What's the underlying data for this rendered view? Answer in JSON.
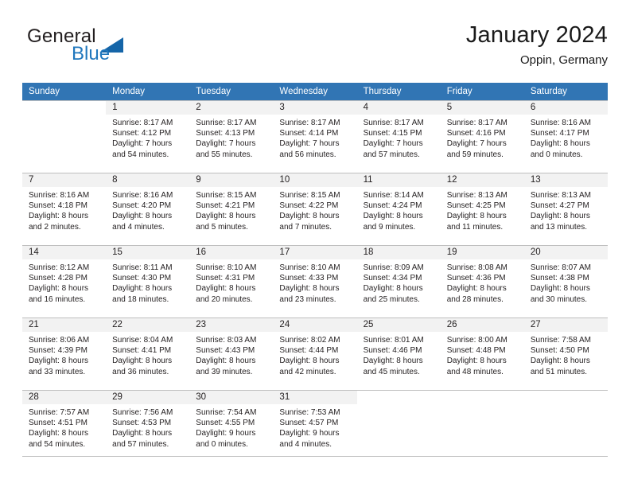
{
  "brand": {
    "word1": "General",
    "word2": "Blue",
    "triangle_color": "#1565a8",
    "blue_color": "#2077bd"
  },
  "header": {
    "title": "January 2024",
    "subtitle": "Oppin, Germany"
  },
  "theme": {
    "header_bg": "#3175b4",
    "daynum_bg": "#f2f2f2",
    "rule_color": "#bfbfbf"
  },
  "weekdays": [
    "Sunday",
    "Monday",
    "Tuesday",
    "Wednesday",
    "Thursday",
    "Friday",
    "Saturday"
  ],
  "weeks": [
    [
      {
        "date": "",
        "sunrise": "",
        "sunset": "",
        "daylight1": "",
        "daylight2": "",
        "empty": true
      },
      {
        "date": "1",
        "sunrise": "Sunrise: 8:17 AM",
        "sunset": "Sunset: 4:12 PM",
        "daylight1": "Daylight: 7 hours",
        "daylight2": "and 54 minutes."
      },
      {
        "date": "2",
        "sunrise": "Sunrise: 8:17 AM",
        "sunset": "Sunset: 4:13 PM",
        "daylight1": "Daylight: 7 hours",
        "daylight2": "and 55 minutes."
      },
      {
        "date": "3",
        "sunrise": "Sunrise: 8:17 AM",
        "sunset": "Sunset: 4:14 PM",
        "daylight1": "Daylight: 7 hours",
        "daylight2": "and 56 minutes."
      },
      {
        "date": "4",
        "sunrise": "Sunrise: 8:17 AM",
        "sunset": "Sunset: 4:15 PM",
        "daylight1": "Daylight: 7 hours",
        "daylight2": "and 57 minutes."
      },
      {
        "date": "5",
        "sunrise": "Sunrise: 8:17 AM",
        "sunset": "Sunset: 4:16 PM",
        "daylight1": "Daylight: 7 hours",
        "daylight2": "and 59 minutes."
      },
      {
        "date": "6",
        "sunrise": "Sunrise: 8:16 AM",
        "sunset": "Sunset: 4:17 PM",
        "daylight1": "Daylight: 8 hours",
        "daylight2": "and 0 minutes."
      }
    ],
    [
      {
        "date": "7",
        "sunrise": "Sunrise: 8:16 AM",
        "sunset": "Sunset: 4:18 PM",
        "daylight1": "Daylight: 8 hours",
        "daylight2": "and 2 minutes."
      },
      {
        "date": "8",
        "sunrise": "Sunrise: 8:16 AM",
        "sunset": "Sunset: 4:20 PM",
        "daylight1": "Daylight: 8 hours",
        "daylight2": "and 4 minutes."
      },
      {
        "date": "9",
        "sunrise": "Sunrise: 8:15 AM",
        "sunset": "Sunset: 4:21 PM",
        "daylight1": "Daylight: 8 hours",
        "daylight2": "and 5 minutes."
      },
      {
        "date": "10",
        "sunrise": "Sunrise: 8:15 AM",
        "sunset": "Sunset: 4:22 PM",
        "daylight1": "Daylight: 8 hours",
        "daylight2": "and 7 minutes."
      },
      {
        "date": "11",
        "sunrise": "Sunrise: 8:14 AM",
        "sunset": "Sunset: 4:24 PM",
        "daylight1": "Daylight: 8 hours",
        "daylight2": "and 9 minutes."
      },
      {
        "date": "12",
        "sunrise": "Sunrise: 8:13 AM",
        "sunset": "Sunset: 4:25 PM",
        "daylight1": "Daylight: 8 hours",
        "daylight2": "and 11 minutes."
      },
      {
        "date": "13",
        "sunrise": "Sunrise: 8:13 AM",
        "sunset": "Sunset: 4:27 PM",
        "daylight1": "Daylight: 8 hours",
        "daylight2": "and 13 minutes."
      }
    ],
    [
      {
        "date": "14",
        "sunrise": "Sunrise: 8:12 AM",
        "sunset": "Sunset: 4:28 PM",
        "daylight1": "Daylight: 8 hours",
        "daylight2": "and 16 minutes."
      },
      {
        "date": "15",
        "sunrise": "Sunrise: 8:11 AM",
        "sunset": "Sunset: 4:30 PM",
        "daylight1": "Daylight: 8 hours",
        "daylight2": "and 18 minutes."
      },
      {
        "date": "16",
        "sunrise": "Sunrise: 8:10 AM",
        "sunset": "Sunset: 4:31 PM",
        "daylight1": "Daylight: 8 hours",
        "daylight2": "and 20 minutes."
      },
      {
        "date": "17",
        "sunrise": "Sunrise: 8:10 AM",
        "sunset": "Sunset: 4:33 PM",
        "daylight1": "Daylight: 8 hours",
        "daylight2": "and 23 minutes."
      },
      {
        "date": "18",
        "sunrise": "Sunrise: 8:09 AM",
        "sunset": "Sunset: 4:34 PM",
        "daylight1": "Daylight: 8 hours",
        "daylight2": "and 25 minutes."
      },
      {
        "date": "19",
        "sunrise": "Sunrise: 8:08 AM",
        "sunset": "Sunset: 4:36 PM",
        "daylight1": "Daylight: 8 hours",
        "daylight2": "and 28 minutes."
      },
      {
        "date": "20",
        "sunrise": "Sunrise: 8:07 AM",
        "sunset": "Sunset: 4:38 PM",
        "daylight1": "Daylight: 8 hours",
        "daylight2": "and 30 minutes."
      }
    ],
    [
      {
        "date": "21",
        "sunrise": "Sunrise: 8:06 AM",
        "sunset": "Sunset: 4:39 PM",
        "daylight1": "Daylight: 8 hours",
        "daylight2": "and 33 minutes."
      },
      {
        "date": "22",
        "sunrise": "Sunrise: 8:04 AM",
        "sunset": "Sunset: 4:41 PM",
        "daylight1": "Daylight: 8 hours",
        "daylight2": "and 36 minutes."
      },
      {
        "date": "23",
        "sunrise": "Sunrise: 8:03 AM",
        "sunset": "Sunset: 4:43 PM",
        "daylight1": "Daylight: 8 hours",
        "daylight2": "and 39 minutes."
      },
      {
        "date": "24",
        "sunrise": "Sunrise: 8:02 AM",
        "sunset": "Sunset: 4:44 PM",
        "daylight1": "Daylight: 8 hours",
        "daylight2": "and 42 minutes."
      },
      {
        "date": "25",
        "sunrise": "Sunrise: 8:01 AM",
        "sunset": "Sunset: 4:46 PM",
        "daylight1": "Daylight: 8 hours",
        "daylight2": "and 45 minutes."
      },
      {
        "date": "26",
        "sunrise": "Sunrise: 8:00 AM",
        "sunset": "Sunset: 4:48 PM",
        "daylight1": "Daylight: 8 hours",
        "daylight2": "and 48 minutes."
      },
      {
        "date": "27",
        "sunrise": "Sunrise: 7:58 AM",
        "sunset": "Sunset: 4:50 PM",
        "daylight1": "Daylight: 8 hours",
        "daylight2": "and 51 minutes."
      }
    ],
    [
      {
        "date": "28",
        "sunrise": "Sunrise: 7:57 AM",
        "sunset": "Sunset: 4:51 PM",
        "daylight1": "Daylight: 8 hours",
        "daylight2": "and 54 minutes."
      },
      {
        "date": "29",
        "sunrise": "Sunrise: 7:56 AM",
        "sunset": "Sunset: 4:53 PM",
        "daylight1": "Daylight: 8 hours",
        "daylight2": "and 57 minutes."
      },
      {
        "date": "30",
        "sunrise": "Sunrise: 7:54 AM",
        "sunset": "Sunset: 4:55 PM",
        "daylight1": "Daylight: 9 hours",
        "daylight2": "and 0 minutes."
      },
      {
        "date": "31",
        "sunrise": "Sunrise: 7:53 AM",
        "sunset": "Sunset: 4:57 PM",
        "daylight1": "Daylight: 9 hours",
        "daylight2": "and 4 minutes."
      },
      {
        "date": "",
        "sunrise": "",
        "sunset": "",
        "daylight1": "",
        "daylight2": "",
        "blank": true
      },
      {
        "date": "",
        "sunrise": "",
        "sunset": "",
        "daylight1": "",
        "daylight2": "",
        "blank": true
      },
      {
        "date": "",
        "sunrise": "",
        "sunset": "",
        "daylight1": "",
        "daylight2": "",
        "blank": true
      }
    ]
  ]
}
